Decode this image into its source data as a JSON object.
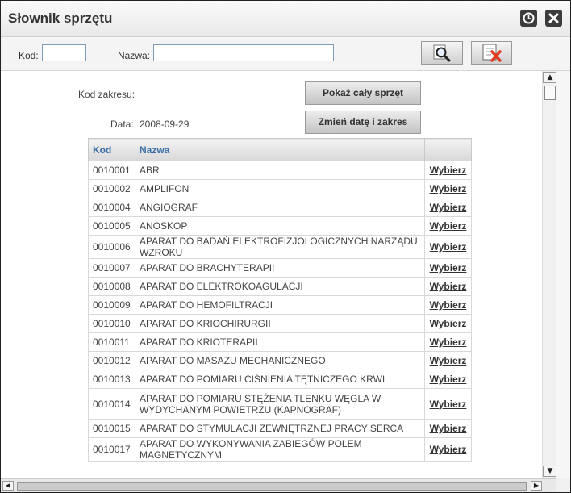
{
  "window": {
    "title": "Słownik sprzętu"
  },
  "titlebar_buttons": {
    "refresh_icon": "refresh-icon",
    "close_icon": "close-icon"
  },
  "filter": {
    "kod_label": "Kod:",
    "kod_value": "",
    "nazwa_label": "Nazwa:",
    "nazwa_value": "",
    "search_icon": "magnifier-icon",
    "clear_icon": "clear-icon"
  },
  "panel": {
    "kod_zakresu_label": "Kod zakresu:",
    "data_label": "Data:",
    "data_value": "2008-09-29",
    "show_all_button": "Pokaż cały sprzęt",
    "change_date_button": "Zmień datę i zakres"
  },
  "table": {
    "headers": [
      "Kod",
      "Nazwa",
      ""
    ],
    "action_label": "Wybierz",
    "rows": [
      {
        "kod": "0010001",
        "nazwa": "ABR"
      },
      {
        "kod": "0010002",
        "nazwa": "AMPLIFON"
      },
      {
        "kod": "0010004",
        "nazwa": "ANGIOGRAF"
      },
      {
        "kod": "0010005",
        "nazwa": "ANOSKOP"
      },
      {
        "kod": "0010006",
        "nazwa": "APARAT DO BADAŃ ELEKTROFIZJOLOGICZNYCH NARZĄDU WZROKU"
      },
      {
        "kod": "0010007",
        "nazwa": "APARAT DO BRACHYTERAPII"
      },
      {
        "kod": "0010008",
        "nazwa": "APARAT DO ELEKTROKOAGULACJI"
      },
      {
        "kod": "0010009",
        "nazwa": "APARAT DO HEMOFILTRACJI"
      },
      {
        "kod": "0010010",
        "nazwa": "APARAT DO KRIOCHIRURGII"
      },
      {
        "kod": "0010011",
        "nazwa": "APARAT DO KRIOTERAPII"
      },
      {
        "kod": "0010012",
        "nazwa": "APARAT DO MASAŻU MECHANICZNEGO"
      },
      {
        "kod": "0010013",
        "nazwa": "APARAT DO POMIARU CIŚNIENIA TĘTNICZEGO KRWI"
      },
      {
        "kod": "0010014",
        "nazwa": "APARAT DO POMIARU STĘŻENIA TLENKU WĘGLA W WYDYCHANYM POWIETRZU (KAPNOGRAF)"
      },
      {
        "kod": "0010015",
        "nazwa": "APARAT DO STYMULACJI ZEWNĘTRZNEJ PRACY SERCA"
      },
      {
        "kod": "0010017",
        "nazwa": "APARAT DO WYKONYWANIA ZABIEGÓW POLEM MAGNETYCZNYM"
      }
    ]
  },
  "colors": {
    "header_text": "#3a6ea5",
    "clear_icon": "#e03b1e"
  }
}
